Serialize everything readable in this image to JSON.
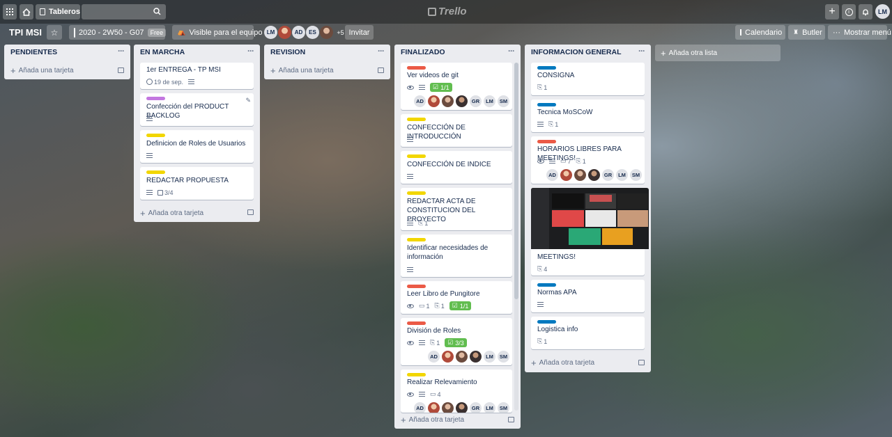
{
  "header": {
    "boards_label": "Tableros",
    "logo": "Trello",
    "user_initials": "LM"
  },
  "board": {
    "title": "TPI MSI",
    "team": "2020 - 2W50 - G07",
    "team_badge": "Free",
    "visibility": "Visible para el equipo",
    "members": [
      "LM",
      "AD",
      "ES"
    ],
    "more_members": "+5",
    "invite": "Invitar",
    "calendar": "Calendario",
    "butler": "Butler",
    "show_menu": "Mostrar menú"
  },
  "colors": {
    "red": "#eb5a46",
    "yellow": "#f2d600",
    "purple": "#c377e0",
    "blue": "#0079bf",
    "green": "#61bd4f"
  },
  "lists": {
    "pendientes": {
      "title": "PENDIENTES",
      "add": "Añada una tarjeta"
    },
    "en_marcha": {
      "title": "EN MARCHA",
      "add": "Añada otra tarjeta",
      "cards": [
        {
          "title": "1er ENTREGA - TP MSI",
          "due": "19 de sep."
        },
        {
          "title": "Confección del PRODUCT BACKLOG"
        },
        {
          "title": "Definicion de Roles de Usuarios"
        },
        {
          "title": "REDACTAR PROPUESTA",
          "checklist": "3/4"
        }
      ]
    },
    "revision": {
      "title": "REVISION",
      "add": "Añada una tarjeta"
    },
    "finalizado": {
      "title": "FINALIZADO",
      "add": "Añada otra tarjeta",
      "cards": [
        {
          "title": "Ver videos de git",
          "checklist": "1/1",
          "members": [
            "AD",
            "GR",
            "LM",
            "SM"
          ]
        },
        {
          "title": "CONFECCIÓN DE INTRODUCCIÓN"
        },
        {
          "title": "CONFECCIÓN DE INDICE"
        },
        {
          "title": "REDACTAR ACTA DE CONSTITUCION DEL PROYECTO",
          "attachments": "1"
        },
        {
          "title": "Identificar necesidades de información"
        },
        {
          "title": "Leer Libro de Pungitore",
          "comments": "1",
          "attachments": "1",
          "checklist": "1/1"
        },
        {
          "title": "División de Roles",
          "attachments": "1",
          "checklist": "3/3",
          "members": [
            "AD",
            "LM",
            "SM"
          ]
        },
        {
          "title": "Realizar Relevamiento",
          "comments": "4",
          "members": [
            "AD",
            "GR",
            "LM",
            "SM"
          ]
        }
      ]
    },
    "informacion": {
      "title": "INFORMACION GENERAL",
      "add": "Añada otra tarjeta",
      "cards": [
        {
          "title": "CONSIGNA",
          "attachments": "1"
        },
        {
          "title": "Tecnica MoSCoW",
          "attachments": "1"
        },
        {
          "title": "HORARIOS LIBRES PARA MEETINGS!",
          "comments": "7",
          "attachments": "1",
          "members": [
            "AD",
            "GR",
            "LM",
            "SM"
          ]
        },
        {
          "title": "MEETINGS!",
          "attachments": "4"
        },
        {
          "title": "Normas APA"
        },
        {
          "title": "Logistica info",
          "attachments": "1"
        }
      ]
    }
  },
  "add_list": "Añada otra lista"
}
